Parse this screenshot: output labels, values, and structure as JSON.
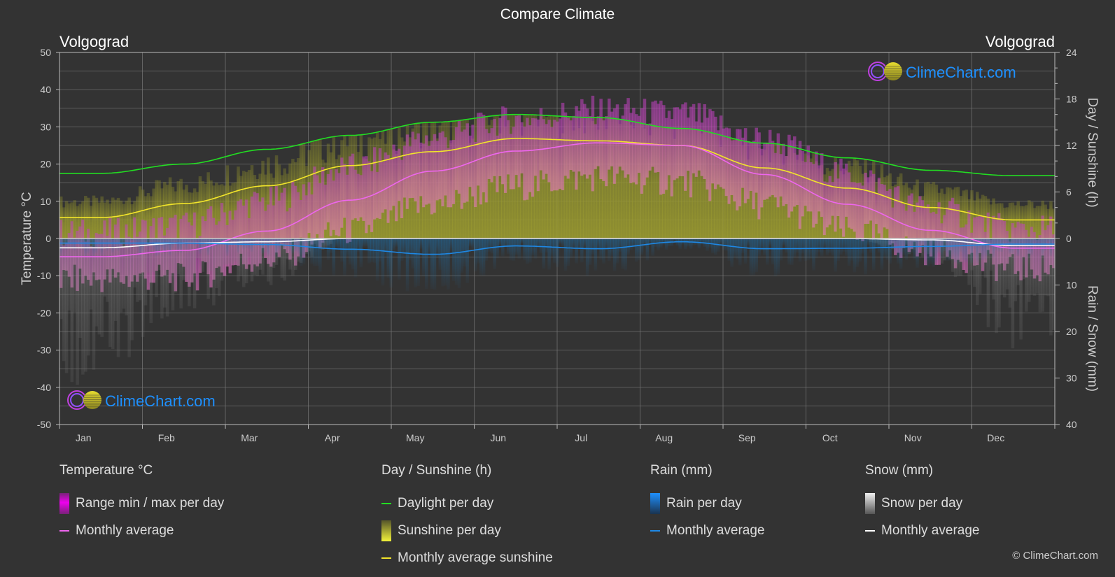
{
  "title": "Compare Climate",
  "city_left": "Volgograd",
  "city_right": "Volgograd",
  "watermark": "ClimeChart.com",
  "copyright": "© ClimeChart.com",
  "colors": {
    "background": "#333333",
    "grid": "#5c5c5c",
    "daylight": "#22dd22",
    "sunshine_avg": "#f2e52a",
    "sunshine_fill": "#9a9a30",
    "temp_avg": "#ee66ee",
    "temp_range": "#dd00dd",
    "rain_avg": "#1e88e5",
    "rain_fill": "#1e6fa8",
    "snow_avg": "#ffffff",
    "snow_fill": "#888888",
    "watermark_text": "#1e90ff"
  },
  "chart_data": {
    "type": "line",
    "title": "Compare Climate",
    "categories": [
      "Jan",
      "Feb",
      "Mar",
      "Apr",
      "May",
      "Jun",
      "Jul",
      "Aug",
      "Sep",
      "Oct",
      "Nov",
      "Dec"
    ],
    "axes": {
      "left": {
        "label": "Temperature °C",
        "range": [
          -50,
          50
        ],
        "ticks": [
          50,
          40,
          30,
          20,
          10,
          0,
          -10,
          -20,
          -30,
          -40,
          -50
        ]
      },
      "right_top": {
        "label": "Day / Sunshine (h)",
        "range": [
          0,
          24
        ],
        "ticks": [
          24,
          18,
          12,
          6,
          0
        ]
      },
      "right_bottom": {
        "label": "Rain / Snow (mm)",
        "range": [
          0,
          40
        ],
        "ticks": [
          0,
          10,
          20,
          30,
          40
        ]
      }
    },
    "grid": true,
    "series": [
      {
        "name": "Daylight per day",
        "axis": "hours",
        "values": [
          8.4,
          9.6,
          11.5,
          13.3,
          15.0,
          16.0,
          15.6,
          14.2,
          12.3,
          10.4,
          8.8,
          8.1
        ]
      },
      {
        "name": "Monthly average sunshine",
        "axis": "hours",
        "values": [
          2.7,
          4.5,
          6.8,
          9.4,
          11.2,
          12.9,
          12.6,
          12.0,
          9.1,
          6.5,
          4.0,
          2.4
        ]
      },
      {
        "name": "Temperature monthly average",
        "axis": "temp",
        "values": [
          -4.9,
          -3.2,
          2.0,
          10.3,
          18.1,
          23.5,
          25.7,
          25.0,
          17.2,
          9.2,
          2.2,
          -2.6
        ]
      },
      {
        "name": "Temperature daily max (approx)",
        "axis": "temp",
        "values": [
          -1.5,
          0.5,
          7.0,
          16.0,
          24.0,
          29.0,
          31.5,
          30.5,
          23.5,
          14.5,
          5.0,
          -0.5
        ]
      },
      {
        "name": "Temperature daily min (approx)",
        "axis": "temp",
        "values": [
          -9.0,
          -8.5,
          -3.5,
          4.0,
          11.0,
          16.0,
          18.5,
          17.0,
          11.0,
          4.0,
          -1.5,
          -6.0
        ]
      },
      {
        "name": "Rain monthly average",
        "axis": "mm",
        "values": [
          1.0,
          1.0,
          1.3,
          2.3,
          3.4,
          1.6,
          2.2,
          0.7,
          2.2,
          2.1,
          1.7,
          1.2
        ]
      },
      {
        "name": "Snow monthly average",
        "axis": "mm",
        "values": [
          2.0,
          1.0,
          0.7,
          0.0,
          0.0,
          0.0,
          0.0,
          0.0,
          0.0,
          0.0,
          0.3,
          1.5
        ]
      }
    ]
  },
  "legend": {
    "temperature": {
      "title": "Temperature °C",
      "items": [
        "Range min / max per day",
        "Monthly average"
      ]
    },
    "sunshine": {
      "title": "Day / Sunshine (h)",
      "items": [
        "Daylight per day",
        "Sunshine per day",
        "Monthly average sunshine"
      ]
    },
    "rain": {
      "title": "Rain (mm)",
      "items": [
        "Rain per day",
        "Monthly average"
      ]
    },
    "snow": {
      "title": "Snow (mm)",
      "items": [
        "Snow per day",
        "Monthly average"
      ]
    }
  }
}
